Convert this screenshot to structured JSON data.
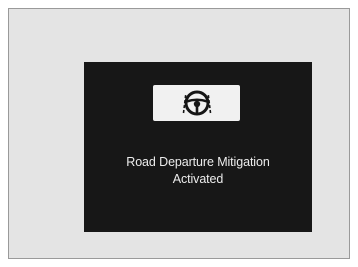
{
  "display": {
    "icon": "road-departure-mitigation-icon",
    "message_line1": "Road Departure Mitigation",
    "message_line2": "Activated"
  },
  "colors": {
    "screen_background": "#171717",
    "text": "#ececec",
    "icon_badge": "#f1f1f1",
    "frame_background": "#e4e4e4"
  }
}
